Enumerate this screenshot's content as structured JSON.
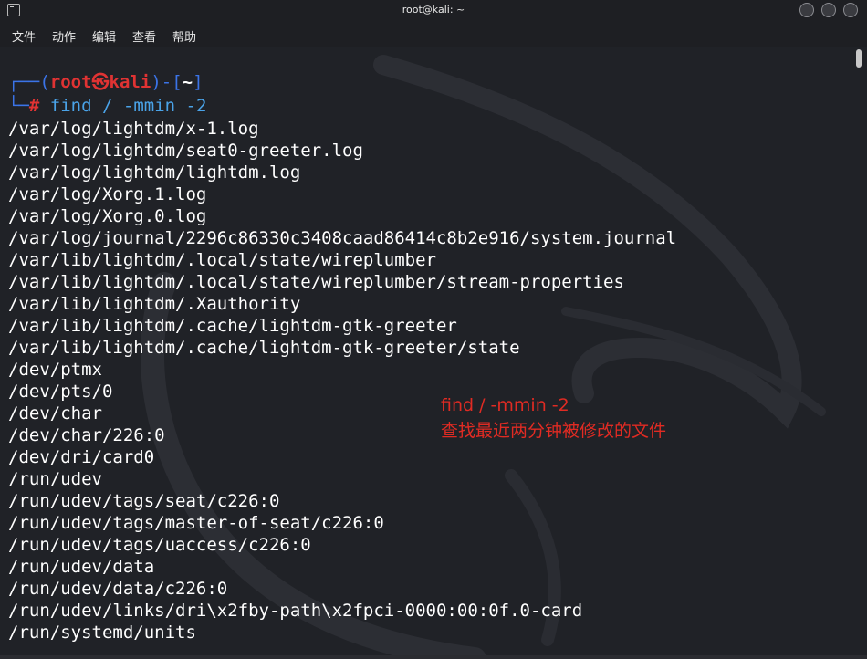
{
  "window": {
    "title": "root@kali: ~"
  },
  "menu": {
    "items": [
      "文件",
      "动作",
      "编辑",
      "查看",
      "帮助"
    ]
  },
  "prompt": {
    "open": "┌──(",
    "user": "root",
    "at": "㉿",
    "host": "kali",
    "close": ")-[",
    "dir": "~",
    "end": "]",
    "hash_prefix": "└─",
    "hash": "#",
    "command": "find",
    "args": " / -mmin -2"
  },
  "output": [
    "/var/log/lightdm/x-1.log",
    "/var/log/lightdm/seat0-greeter.log",
    "/var/log/lightdm/lightdm.log",
    "/var/log/Xorg.1.log",
    "/var/log/Xorg.0.log",
    "/var/log/journal/2296c86330c3408caad86414c8b2e916/system.journal",
    "/var/lib/lightdm/.local/state/wireplumber",
    "/var/lib/lightdm/.local/state/wireplumber/stream-properties",
    "/var/lib/lightdm/.Xauthority",
    "/var/lib/lightdm/.cache/lightdm-gtk-greeter",
    "/var/lib/lightdm/.cache/lightdm-gtk-greeter/state",
    "/dev/ptmx",
    "/dev/pts/0",
    "/dev/char",
    "/dev/char/226:0",
    "/dev/dri/card0",
    "/run/udev",
    "/run/udev/tags/seat/c226:0",
    "/run/udev/tags/master-of-seat/c226:0",
    "/run/udev/tags/uaccess/c226:0",
    "/run/udev/data",
    "/run/udev/data/c226:0",
    "/run/udev/links/dri\\x2fby-path\\x2fpci-0000:00:0f.0-card",
    "/run/systemd/units"
  ],
  "annotation": {
    "line1": "find / -mmin -2",
    "line2": "查找最近两分钟被修改的文件"
  },
  "colors": {
    "annotation": "#e02b23",
    "prompt_frame": "#3b74e8",
    "prompt_user": "#e03333"
  }
}
